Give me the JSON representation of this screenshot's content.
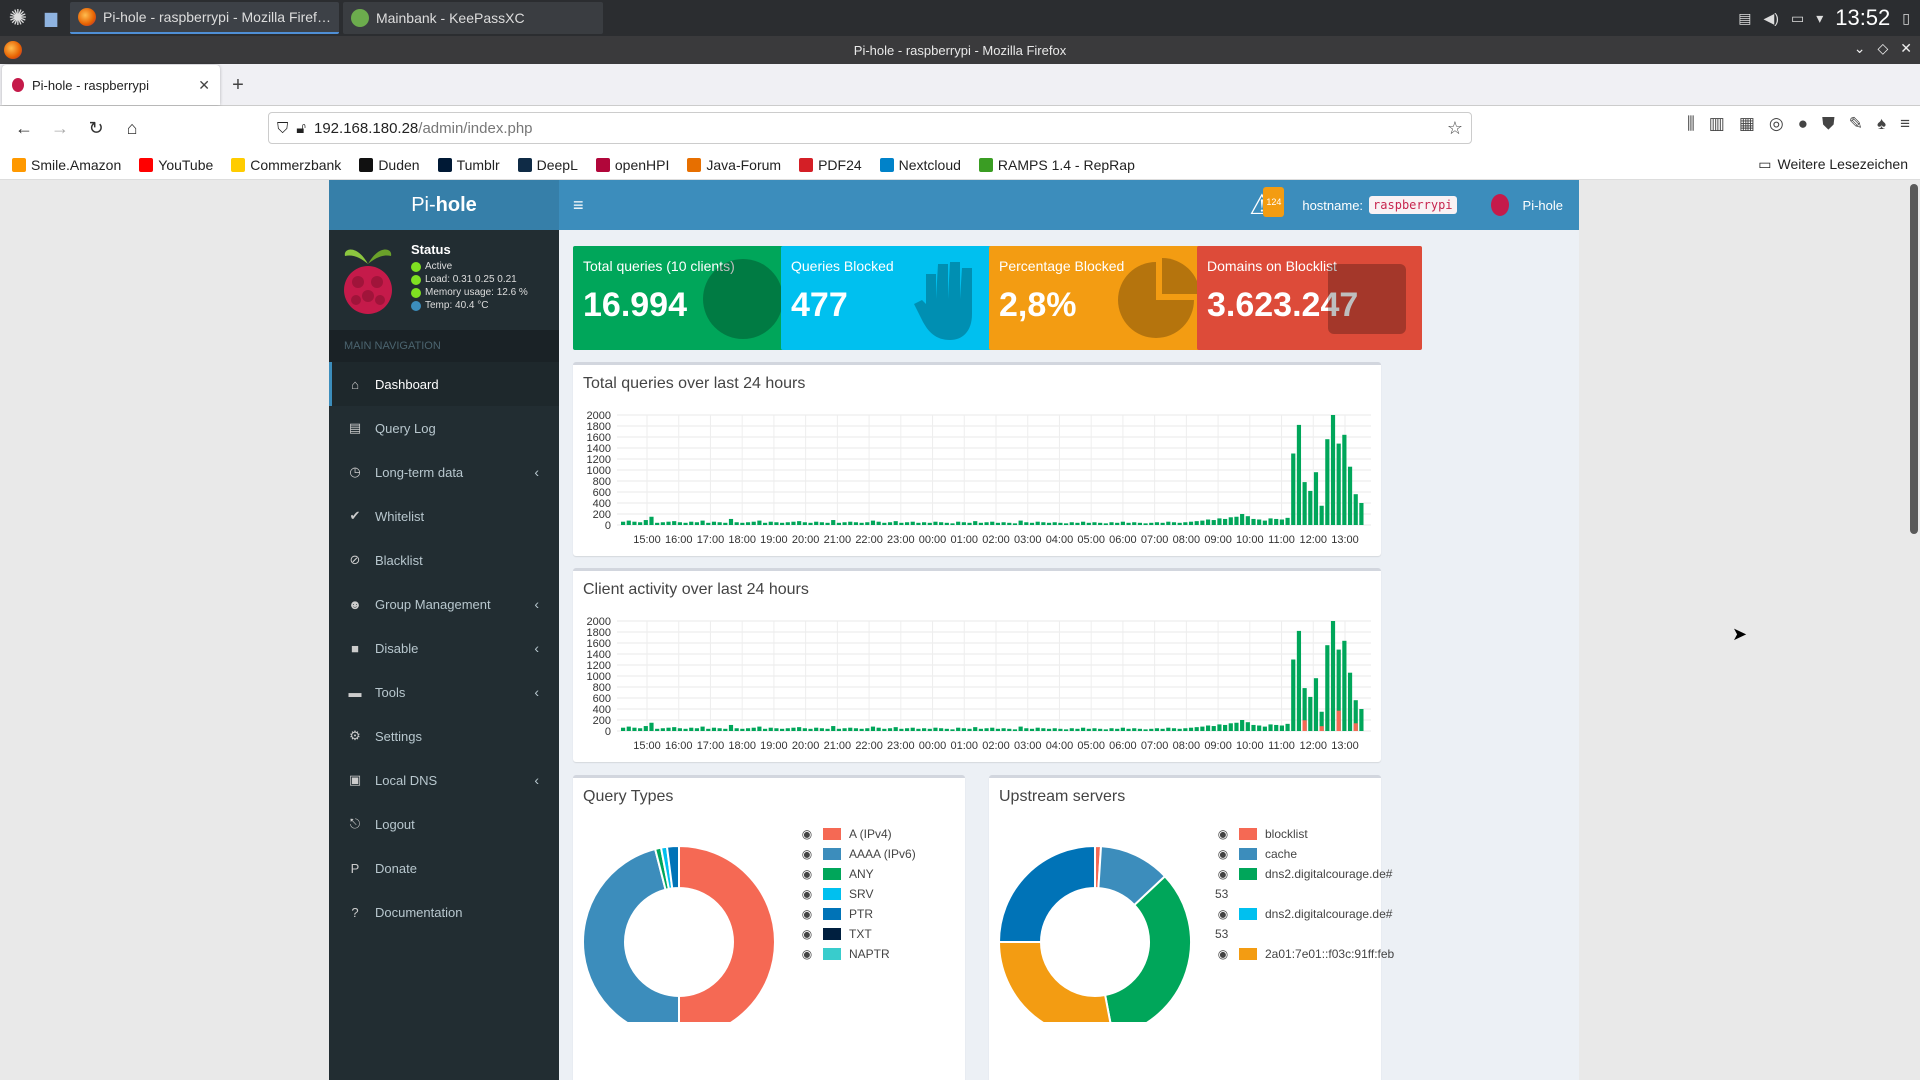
{
  "taskbar": {
    "tasks": [
      {
        "label": "Pi-hole - raspberrypi - Mozilla Firef…",
        "active": true
      },
      {
        "label": "Mainbank - KeePassXC",
        "active": false
      }
    ],
    "clock": "13:52"
  },
  "window": {
    "title": "Pi-hole - raspberrypi - Mozilla Firefox"
  },
  "browser": {
    "tab_title": "Pi-hole - raspberrypi",
    "url_host": "192.168.180.28",
    "url_path": "/admin/index.php",
    "bookmarks": [
      {
        "label": "Smile.Amazon",
        "color": "#ff9900"
      },
      {
        "label": "YouTube",
        "color": "#ff0000"
      },
      {
        "label": "Commerzbank",
        "color": "#ffcc00"
      },
      {
        "label": "Duden",
        "color": "#111111"
      },
      {
        "label": "Tumblr",
        "color": "#001935"
      },
      {
        "label": "DeepL",
        "color": "#0f2b46"
      },
      {
        "label": "openHPI",
        "color": "#b1063a"
      },
      {
        "label": "Java-Forum",
        "color": "#e76f00"
      },
      {
        "label": "PDF24",
        "color": "#d41f26"
      },
      {
        "label": "Nextcloud",
        "color": "#0082c9"
      },
      {
        "label": "RAMPS 1.4 - RepRap",
        "color": "#3a9d23"
      }
    ],
    "more_bookmarks": "Weitere Lesezeichen"
  },
  "pihole": {
    "logo_light": "Pi-",
    "logo_bold": "hole",
    "status": {
      "title": "Status",
      "active": "Active",
      "load": "Load:  0.31  0.25  0.21",
      "memory": "Memory usage:  12.6 %",
      "temp": "Temp: 40.4 °C"
    },
    "nav_header": "MAIN NAVIGATION",
    "nav": [
      {
        "label": "Dashboard",
        "icon": "home-icon",
        "glyph": "⌂",
        "sub": false,
        "active": true
      },
      {
        "label": "Query Log",
        "icon": "file-icon",
        "glyph": "▤",
        "sub": false
      },
      {
        "label": "Long-term data",
        "icon": "history-icon",
        "glyph": "◷",
        "sub": true
      },
      {
        "label": "Whitelist",
        "icon": "check-circle-icon",
        "glyph": "✔",
        "sub": false
      },
      {
        "label": "Blacklist",
        "icon": "ban-icon",
        "glyph": "⊘",
        "sub": false
      },
      {
        "label": "Group Management",
        "icon": "users-icon",
        "glyph": "☻",
        "sub": true
      },
      {
        "label": "Disable",
        "icon": "stop-icon",
        "glyph": "■",
        "sub": true
      },
      {
        "label": "Tools",
        "icon": "folder-icon",
        "glyph": "▬",
        "sub": true
      },
      {
        "label": "Settings",
        "icon": "gears-icon",
        "glyph": "⚙",
        "sub": false
      },
      {
        "label": "Local DNS",
        "icon": "address-book-icon",
        "glyph": "▣",
        "sub": true
      },
      {
        "label": "Logout",
        "icon": "user-times-icon",
        "glyph": "⎋",
        "sub": false
      },
      {
        "label": "Donate",
        "icon": "paypal-icon",
        "glyph": "P",
        "sub": false
      },
      {
        "label": "Documentation",
        "icon": "question-circle-icon",
        "glyph": "?",
        "sub": false
      }
    ],
    "topbar": {
      "warning_count": "124",
      "hostname_label": "hostname:",
      "hostname": "raspberrypi",
      "user": "Pi-hole"
    },
    "boxes": [
      {
        "label": "Total queries (10 clients)",
        "value": "16.994",
        "color": "#00a65a"
      },
      {
        "label": "Queries Blocked",
        "value": "477",
        "color": "#00c0ef"
      },
      {
        "label": "Percentage Blocked",
        "value": "2,8%",
        "color": "#f39c12"
      },
      {
        "label": "Domains on Blocklist",
        "value": "3.623.247",
        "color": "#dd4b39"
      }
    ],
    "query_types": {
      "title": "Query Types",
      "items": [
        {
          "label": "A (IPv4)",
          "color": "#f56954"
        },
        {
          "label": "AAAA (IPv6)",
          "color": "#3c8dbc"
        },
        {
          "label": "ANY",
          "color": "#00a65a"
        },
        {
          "label": "SRV",
          "color": "#00c0ef"
        },
        {
          "label": "PTR",
          "color": "#0073b7"
        },
        {
          "label": "TXT",
          "color": "#001f3f"
        },
        {
          "label": "NAPTR",
          "color": "#39cccc"
        }
      ]
    },
    "upstream": {
      "title": "Upstream servers",
      "items": [
        {
          "label": "blocklist",
          "color": "#f56954"
        },
        {
          "label": "cache",
          "color": "#3c8dbc"
        },
        {
          "label": "dns2.digitalcourage.de#",
          "color": "#00a65a"
        },
        {
          "label": "53",
          "color": ""
        },
        {
          "label": "dns2.digitalcourage.de#",
          "color": "#00c0ef"
        },
        {
          "label": "53",
          "color": ""
        },
        {
          "label": "2a01:7e01::f03c:91ff:feb",
          "color": "#f39c12"
        }
      ]
    }
  },
  "chart_data": [
    {
      "type": "bar",
      "title": "Total queries over last 24 hours",
      "ylim": [
        0,
        2000
      ],
      "yticks": [
        0,
        200,
        400,
        600,
        800,
        1000,
        1200,
        1400,
        1600,
        1800,
        2000
      ],
      "xticks": [
        "15:00",
        "16:00",
        "17:00",
        "18:00",
        "19:00",
        "20:00",
        "21:00",
        "22:00",
        "23:00",
        "00:00",
        "01:00",
        "02:00",
        "03:00",
        "04:00",
        "05:00",
        "06:00",
        "07:00",
        "08:00",
        "09:00",
        "10:00",
        "11:00",
        "12:00",
        "13:00"
      ],
      "series": [
        {
          "values": [
            60,
            80,
            60,
            50,
            90,
            150,
            40,
            50,
            60,
            70,
            50,
            40,
            60,
            50,
            80,
            40,
            60,
            50,
            40,
            110,
            50,
            40,
            50,
            60,
            80,
            40,
            60,
            50,
            40,
            50,
            60,
            70,
            50,
            40,
            60,
            50,
            40,
            90,
            40,
            50,
            60,
            50,
            40,
            50,
            80,
            60,
            40,
            50,
            70,
            40,
            50,
            60,
            40,
            50,
            40,
            60,
            50,
            40,
            30,
            60,
            50,
            40,
            70,
            40,
            50,
            60,
            40,
            50,
            40,
            30,
            80,
            50,
            40,
            60,
            50,
            40,
            50,
            40,
            30,
            50,
            40,
            60,
            40,
            50,
            40,
            30,
            50,
            40,
            60,
            40,
            50,
            40,
            30,
            40,
            50,
            40,
            60,
            50,
            40,
            50,
            60,
            70,
            80,
            100,
            90,
            120,
            110,
            140,
            150,
            200,
            160,
            110,
            100,
            80,
            120,
            110,
            100,
            130,
            1300,
            1820,
            780,
            620,
            960,
            350,
            1560,
            2000,
            1480,
            1640,
            1060,
            560,
            400
          ]
        }
      ]
    },
    {
      "type": "bar",
      "title": "Client activity over last 24 hours",
      "ylim": [
        0,
        2000
      ],
      "yticks": [
        0,
        200,
        400,
        600,
        800,
        1000,
        1200,
        1400,
        1600,
        1800,
        2000
      ],
      "xticks": [
        "15:00",
        "16:00",
        "17:00",
        "18:00",
        "19:00",
        "20:00",
        "21:00",
        "22:00",
        "23:00",
        "00:00",
        "01:00",
        "02:00",
        "03:00",
        "04:00",
        "05:00",
        "06:00",
        "07:00",
        "08:00",
        "09:00",
        "10:00",
        "11:00",
        "12:00",
        "13:00"
      ],
      "series": [
        {
          "values": [
            60,
            80,
            60,
            50,
            90,
            150,
            40,
            50,
            60,
            70,
            50,
            40,
            60,
            50,
            80,
            40,
            60,
            50,
            40,
            110,
            50,
            40,
            50,
            60,
            80,
            40,
            60,
            50,
            40,
            50,
            60,
            70,
            50,
            40,
            60,
            50,
            40,
            90,
            40,
            50,
            60,
            50,
            40,
            50,
            80,
            60,
            40,
            50,
            70,
            40,
            50,
            60,
            40,
            50,
            40,
            60,
            50,
            40,
            30,
            60,
            50,
            40,
            70,
            40,
            50,
            60,
            40,
            50,
            40,
            30,
            80,
            50,
            40,
            60,
            50,
            40,
            50,
            40,
            30,
            50,
            40,
            60,
            40,
            50,
            40,
            30,
            50,
            40,
            60,
            40,
            50,
            40,
            30,
            40,
            50,
            40,
            60,
            50,
            40,
            50,
            60,
            70,
            80,
            100,
            90,
            120,
            110,
            140,
            150,
            200,
            160,
            110,
            100,
            80,
            120,
            110,
            100,
            130,
            1300,
            1820,
            780,
            620,
            960,
            350,
            1560,
            2000,
            1480,
            1640,
            1060,
            560,
            400
          ]
        }
      ]
    }
  ],
  "donuts": {
    "query_types": [
      {
        "value": 50,
        "color": "#f56954"
      },
      {
        "value": 46,
        "color": "#3c8dbc"
      },
      {
        "value": 1,
        "color": "#00a65a"
      },
      {
        "value": 1,
        "color": "#00c0ef"
      },
      {
        "value": 2,
        "color": "#0073b7"
      }
    ],
    "upstream": [
      {
        "value": 1,
        "color": "#f56954"
      },
      {
        "value": 12,
        "color": "#3c8dbc"
      },
      {
        "value": 34,
        "color": "#00a65a"
      },
      {
        "value": 28,
        "color": "#f39c12"
      },
      {
        "value": 25,
        "color": "#0073b7"
      }
    ]
  }
}
